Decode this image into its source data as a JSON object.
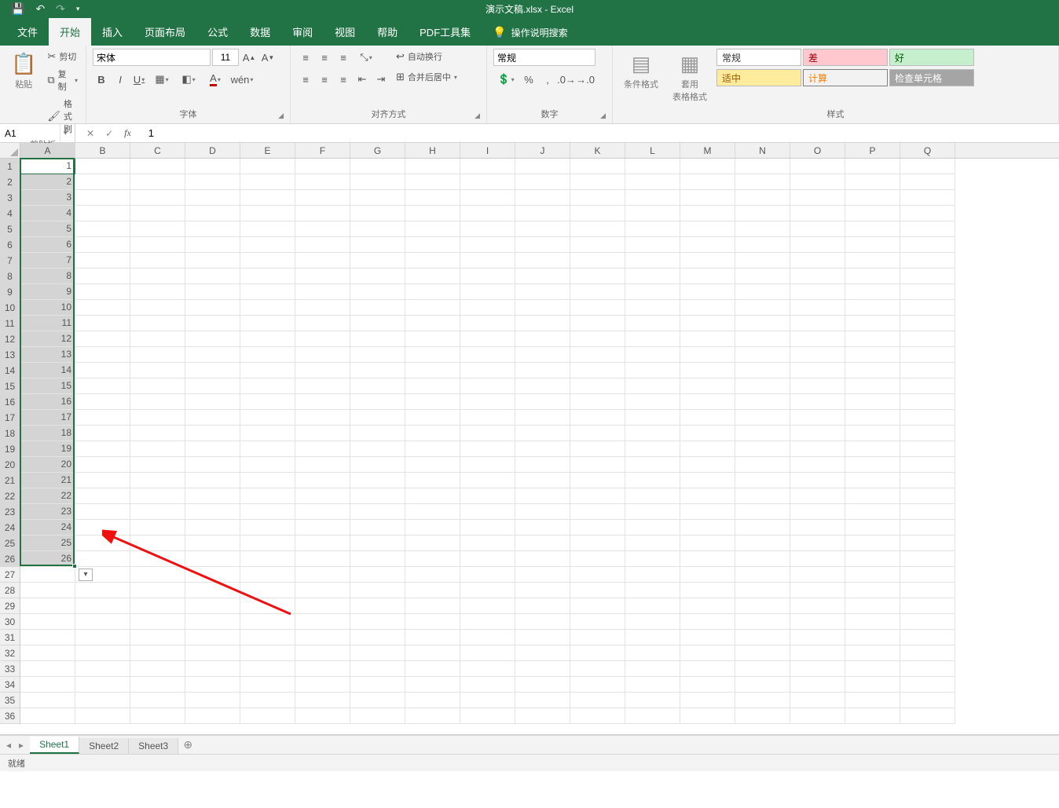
{
  "title": "演示文稿.xlsx  -  Excel",
  "qat": {
    "save": "💾",
    "undo": "↶",
    "redo": "↷",
    "customize": "▾"
  },
  "tabs": {
    "file": "文件",
    "home": "开始",
    "insert": "插入",
    "page_layout": "页面布局",
    "formulas": "公式",
    "data": "数据",
    "review": "审阅",
    "view": "视图",
    "help": "帮助",
    "pdf": "PDF工具集",
    "tell_me": "操作说明搜索"
  },
  "ribbon": {
    "clipboard": {
      "paste": "粘贴",
      "cut": "剪切",
      "copy": "复制",
      "format_painter": "格式刷",
      "label": "剪贴板"
    },
    "font": {
      "name": "宋体",
      "size": "11",
      "label": "字体"
    },
    "alignment": {
      "wrap": "自动换行",
      "merge": "合并后居中",
      "label": "对齐方式"
    },
    "number": {
      "format": "常规",
      "label": "数字"
    },
    "styles": {
      "cond_fmt": "条件格式",
      "table_fmt": "套用\n表格格式",
      "normal": "常规",
      "bad": "差",
      "good": "好",
      "neutral": "适中",
      "calc": "计算",
      "check": "检查单元格",
      "label": "样式"
    }
  },
  "formula_bar": {
    "name_box": "A1",
    "formula": "1"
  },
  "grid": {
    "columns": [
      "A",
      "B",
      "C",
      "D",
      "E",
      "F",
      "G",
      "H",
      "I",
      "J",
      "K",
      "L",
      "M",
      "N",
      "O",
      "P",
      "Q"
    ],
    "row_count": 36,
    "data_col": "A",
    "data": [
      1,
      2,
      3,
      4,
      5,
      6,
      7,
      8,
      9,
      10,
      11,
      12,
      13,
      14,
      15,
      16,
      17,
      18,
      19,
      20,
      21,
      22,
      23,
      24,
      25,
      26
    ],
    "selected_rows": 26,
    "active_row": 1
  },
  "sheets": {
    "items": [
      "Sheet1",
      "Sheet2",
      "Sheet3"
    ],
    "active": 0
  },
  "status": "就绪"
}
